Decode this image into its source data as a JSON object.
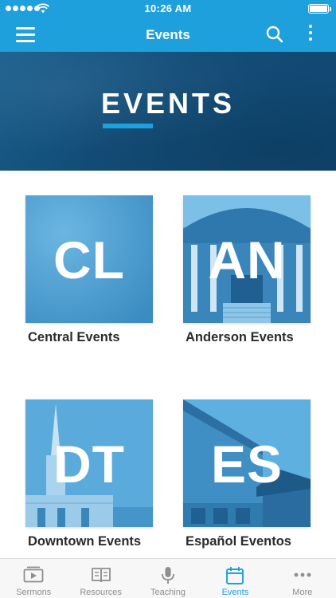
{
  "status_bar": {
    "time": "10:26 AM"
  },
  "nav": {
    "title": "Events",
    "menu_icon": "menu-icon",
    "search_icon": "search-icon",
    "more_icon": "more-vertical-icon"
  },
  "hero": {
    "title": "EVENTS"
  },
  "tiles": [
    {
      "letters": "CL",
      "label": "Central Events"
    },
    {
      "letters": "AN",
      "label": "Anderson Events"
    },
    {
      "letters": "DT",
      "label": "Downtown Events"
    },
    {
      "letters": "ES",
      "label": "Español Eventos"
    }
  ],
  "tab_bar": {
    "tabs": [
      {
        "label": "Sermons",
        "icon": "video-icon"
      },
      {
        "label": "Resources",
        "icon": "book-icon"
      },
      {
        "label": "Teaching",
        "icon": "microphone-icon"
      },
      {
        "label": "Events",
        "icon": "calendar-icon",
        "active": true
      },
      {
        "label": "More",
        "icon": "more-horizontal-icon"
      }
    ]
  },
  "colors": {
    "accent": "#1da0dc",
    "hero": "#124d78",
    "tab_inactive": "#8e8e93"
  }
}
